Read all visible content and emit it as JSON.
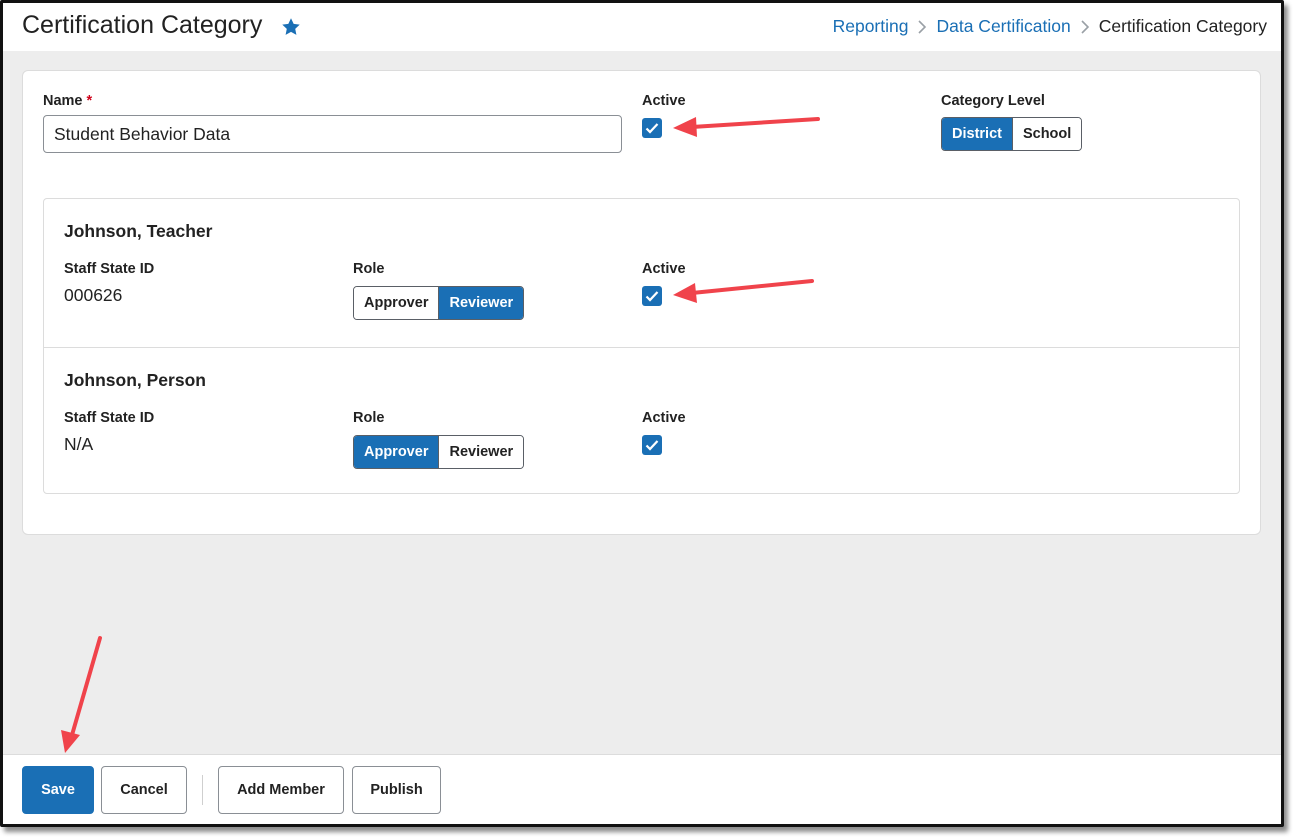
{
  "page": {
    "title": "Certification Category",
    "breadcrumb": [
      "Reporting",
      "Data Certification",
      "Certification Category"
    ]
  },
  "form": {
    "name_label": "Name",
    "required_mark": "*",
    "name_value": "Student Behavior Data",
    "active_label": "Active",
    "active_checked": true,
    "category_level_label": "Category Level",
    "category_level_options": [
      "District",
      "School"
    ],
    "category_level_selected": "District"
  },
  "members": [
    {
      "name": "Johnson, Teacher",
      "staff_state_id_label": "Staff State ID",
      "staff_state_id": "000626",
      "role_label": "Role",
      "role_options": [
        "Approver",
        "Reviewer"
      ],
      "role_selected": "Reviewer",
      "active_label": "Active",
      "active_checked": true
    },
    {
      "name": "Johnson, Person",
      "staff_state_id_label": "Staff State ID",
      "staff_state_id": "N/A",
      "role_label": "Role",
      "role_options": [
        "Approver",
        "Reviewer"
      ],
      "role_selected": "Approver",
      "active_label": "Active",
      "active_checked": true
    }
  ],
  "footer": {
    "save": "Save",
    "cancel": "Cancel",
    "add_member": "Add Member",
    "publish": "Publish"
  },
  "colors": {
    "accent": "#1a6fb5",
    "annotation_arrow": "#f0434b",
    "background": "#ededed"
  }
}
